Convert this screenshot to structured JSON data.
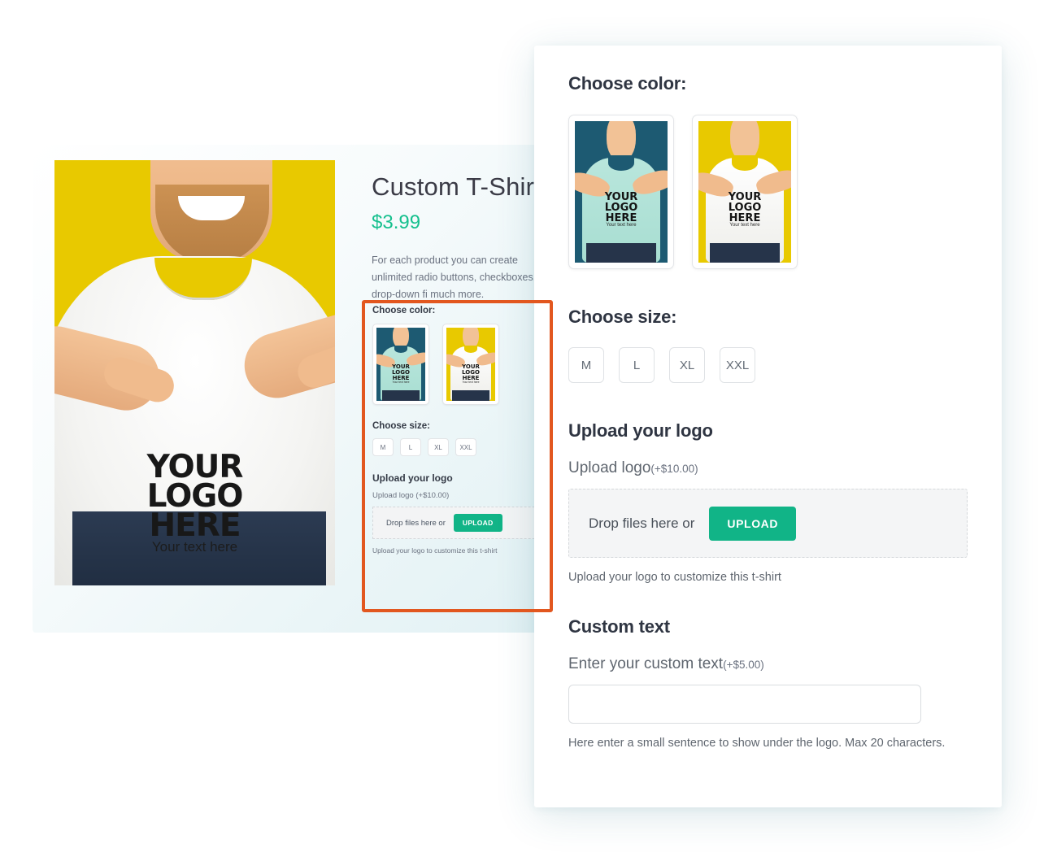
{
  "product": {
    "title": "Custom T-Shirt",
    "price": "$3.99",
    "description": "For each product you can create unlimited radio buttons, checkboxes, drop-down fi much more."
  },
  "options": {
    "color": {
      "label": "Choose color:",
      "swatches": [
        {
          "name": "mint-teal",
          "shirt_color": "#b2e2d6",
          "bg_color": "#1d5a72",
          "logo_text": "YOUR LOGO HERE",
          "custom_text": "Your text here"
        },
        {
          "name": "white-yellow",
          "shirt_color": "#ffffff",
          "bg_color": "#e8c900",
          "logo_text": "YOUR LOGO HERE",
          "custom_text": "Your text here"
        }
      ]
    },
    "size": {
      "label": "Choose size:",
      "values": [
        "M",
        "L",
        "XL",
        "XXL"
      ]
    },
    "upload": {
      "heading": "Upload your logo",
      "field_label": "Upload logo",
      "field_price": "(+$10.00)",
      "drop_text": "Drop files here or",
      "button_label": "UPLOAD",
      "help_text": "Upload your logo to customize this t-shirt"
    },
    "custom_text": {
      "heading": "Custom text",
      "field_label": "Enter your custom text",
      "field_price": "(+$5.00)",
      "input_value": "",
      "input_placeholder": "",
      "help_text": "Here enter a small sentence to show under the logo. Max 20 characters."
    }
  },
  "main_image": {
    "logo_line1": "YOUR",
    "logo_line2": "LOGO",
    "logo_line3": "HERE",
    "custom_text": "Your text here",
    "background_color": "#e8c900"
  },
  "colors": {
    "accent_green": "#11b487",
    "price_green": "#16c08e",
    "highlight_orange": "#e2571f",
    "heading_dark": "#2f3542",
    "body_gray": "#6b7280"
  }
}
